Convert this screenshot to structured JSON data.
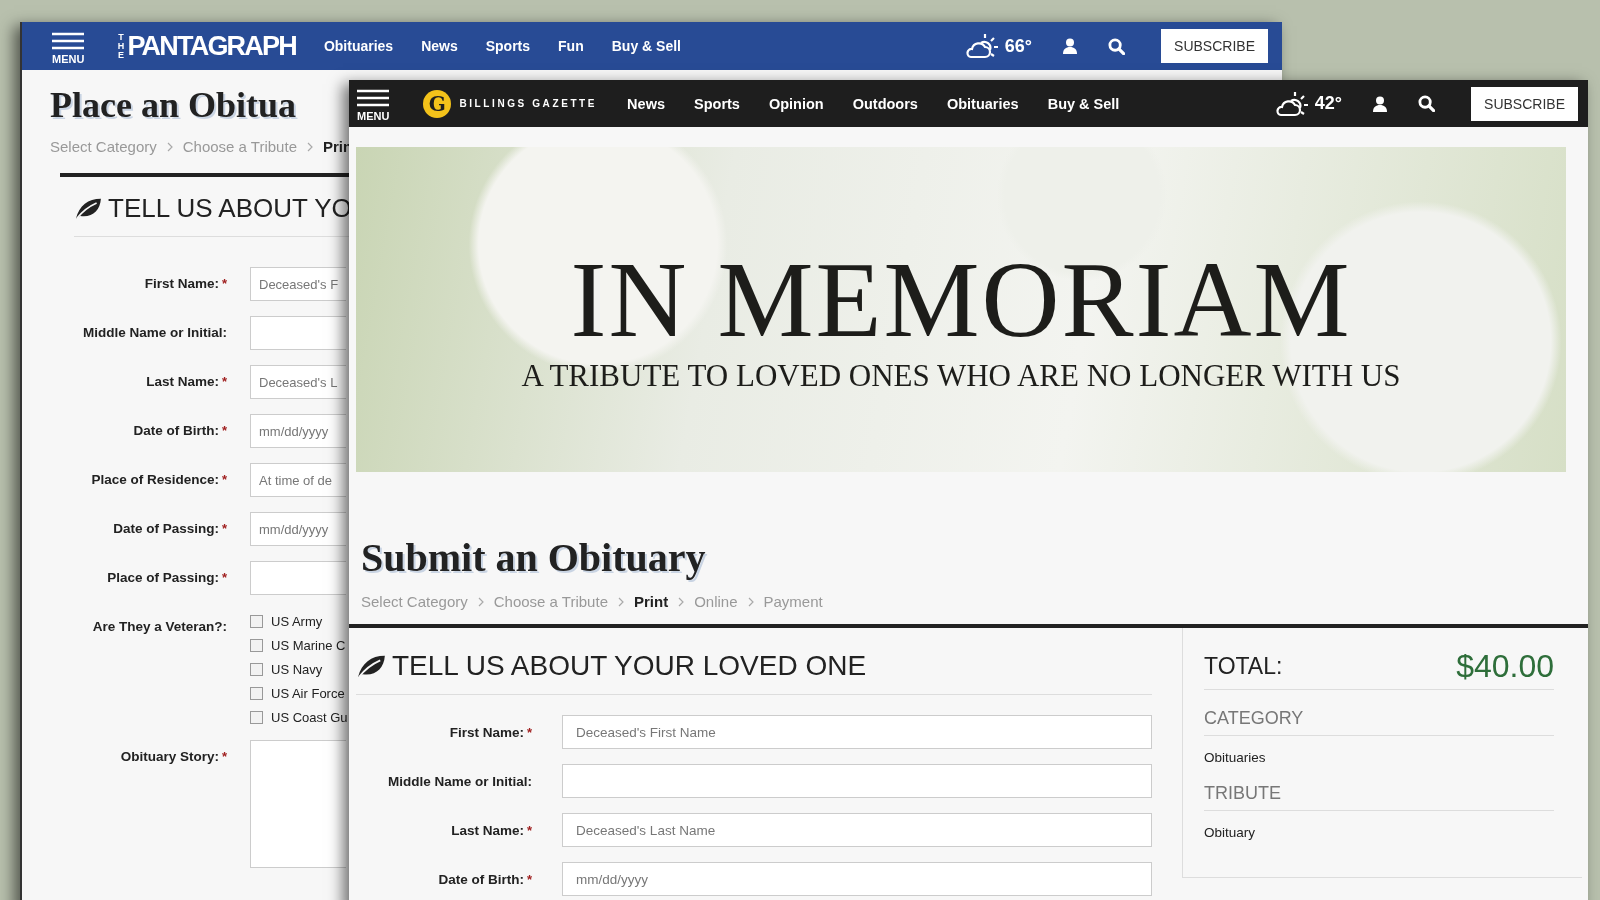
{
  "back_window": {
    "header": {
      "menu_label": "MENU",
      "logo_small": "THE",
      "logo": "PANTAGRAPH",
      "nav": [
        "Obituaries",
        "News",
        "Sports",
        "Fun",
        "Buy & Sell"
      ],
      "temperature": "66°",
      "subscribe": "SUBSCRIBE"
    },
    "title": "Place an Obitua",
    "breadcrumb": [
      {
        "label": "Select Category",
        "selected": false
      },
      {
        "label": "Choose a Tribute",
        "selected": false
      },
      {
        "label": "Prin",
        "selected": true
      }
    ],
    "section_heading": "TELL US ABOUT YO",
    "fields": [
      {
        "kind": "text",
        "label": "First Name:",
        "required_mark": "*",
        "placeholder": "Deceased's F"
      },
      {
        "kind": "text",
        "label": "Middle Name or Initial:"
      },
      {
        "kind": "text",
        "label": "Last Name:",
        "required_mark": "*",
        "placeholder": "Deceased's L"
      },
      {
        "kind": "text",
        "label": "Date of Birth:",
        "required_mark": "*",
        "placeholder": "mm/dd/yyyy"
      },
      {
        "kind": "text",
        "label": "Place of Residence:",
        "required_mark": "*",
        "placeholder": "At time of de"
      },
      {
        "kind": "text",
        "label": "Date of Passing:",
        "required_mark": "*",
        "placeholder": "mm/dd/yyyy"
      },
      {
        "kind": "text",
        "label": "Place of Passing:",
        "required_mark": "*"
      },
      {
        "kind": "checkboxes",
        "label": "Are They a Veteran?:",
        "options": [
          {
            "label": "US Army",
            "checked": false
          },
          {
            "label": "US Marine C",
            "checked": false
          },
          {
            "label": "US Navy",
            "checked": false
          },
          {
            "label": "US Air Force",
            "checked": false
          },
          {
            "label": "US Coast Gu",
            "checked": false
          }
        ]
      },
      {
        "kind": "textarea",
        "label": "Obituary Story:",
        "required_mark": "*"
      }
    ]
  },
  "front_window": {
    "header": {
      "menu_label": "MENU",
      "logo_letter": "G",
      "logo": "BILLINGS GAZETTE",
      "nav": [
        "News",
        "Sports",
        "Opinion",
        "Outdoors",
        "Obituaries",
        "Buy & Sell"
      ],
      "temperature": "42°",
      "subscribe": "SUBSCRIBE"
    },
    "banner": {
      "title": "IN MEMORIAM",
      "subtitle": "A TRIBUTE TO LOVED ONES WHO ARE NO LONGER WITH US"
    },
    "title": "Submit an Obituary",
    "breadcrumb": [
      {
        "label": "Select Category",
        "selected": false
      },
      {
        "label": "Choose a Tribute",
        "selected": false
      },
      {
        "label": "Print",
        "selected": true
      },
      {
        "label": "Online",
        "selected": false
      },
      {
        "label": "Payment",
        "selected": false
      }
    ],
    "section_heading": "TELL US ABOUT YOUR LOVED ONE",
    "fields": [
      {
        "kind": "text",
        "label": "First Name:",
        "required_mark": "*",
        "placeholder": "Deceased's First Name"
      },
      {
        "kind": "text",
        "label": "Middle Name or Initial:"
      },
      {
        "kind": "text",
        "label": "Last Name:",
        "required_mark": "*",
        "placeholder": "Deceased's Last Name"
      },
      {
        "kind": "text",
        "label": "Date of Birth:",
        "required_mark": "*",
        "placeholder": "mm/dd/yyyy"
      }
    ],
    "summary": {
      "total_label": "TOTAL:",
      "total": "$40.00",
      "sections": [
        {
          "heading": "CATEGORY",
          "value": "Obituaries"
        },
        {
          "heading": "TRIBUTE",
          "value": "Obituary"
        }
      ]
    }
  }
}
